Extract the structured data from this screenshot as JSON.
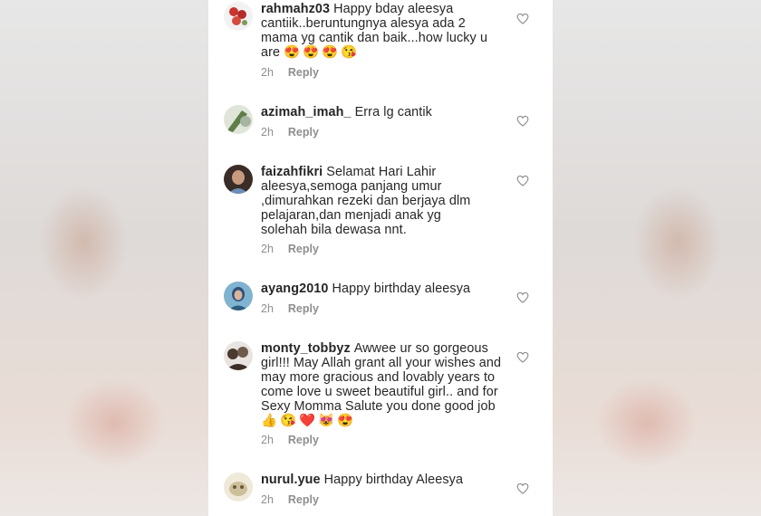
{
  "comments": [
    {
      "username": "rahmahz03",
      "text": "Happy bday aleesya cantiik..beruntungnya alesya ada 2 mama yg cantik dan baik...how lucky u are",
      "emojis": [
        "😍",
        "😍",
        "😍",
        "😘"
      ],
      "time": "2h",
      "reply_label": "Reply",
      "avatar_color": "#c8342f",
      "icon": "heart-outline-icon"
    },
    {
      "username": "azimah_imah_",
      "text": "Erra lg cantik",
      "emojis": [],
      "time": "2h",
      "reply_label": "Reply",
      "avatar_color": "#6e8a4a",
      "icon": "heart-outline-icon"
    },
    {
      "username": "faizahfikri",
      "text": "Selamat Hari Lahir aleesya,semoga panjang umur ,dimurahkan rezeki dan  berjaya dlm pelajaran,dan menjadi anak yg solehah bila dewasa nnt.",
      "emojis": [],
      "time": "2h",
      "reply_label": "Reply",
      "avatar_color": "#4b3a32",
      "icon": "heart-outline-icon"
    },
    {
      "username": "ayang2010",
      "text": "Happy birthday aleesya",
      "emojis": [],
      "time": "2h",
      "reply_label": "Reply",
      "avatar_color": "#2f6f8f",
      "icon": "heart-outline-icon"
    },
    {
      "username": "monty_tobbyz",
      "text": "Awwee ur so gorgeous girl!!! May Allah grant all your wishes and may more gracious and lovably years to come love u sweet beautiful girl.. and for Sexy Momma Salute you done good job",
      "emojis": [
        "👍",
        "😘",
        "❤️",
        "😻",
        "😍"
      ],
      "time": "2h",
      "reply_label": "Reply",
      "avatar_color": "#5a4a3e",
      "icon": "heart-outline-icon"
    },
    {
      "username": "nurul.yue",
      "text": "Happy birthday Aleesya",
      "emojis": [],
      "time": "2h",
      "reply_label": "Reply",
      "avatar_color": "#cdbf9a",
      "icon": "heart-outline-icon"
    }
  ]
}
